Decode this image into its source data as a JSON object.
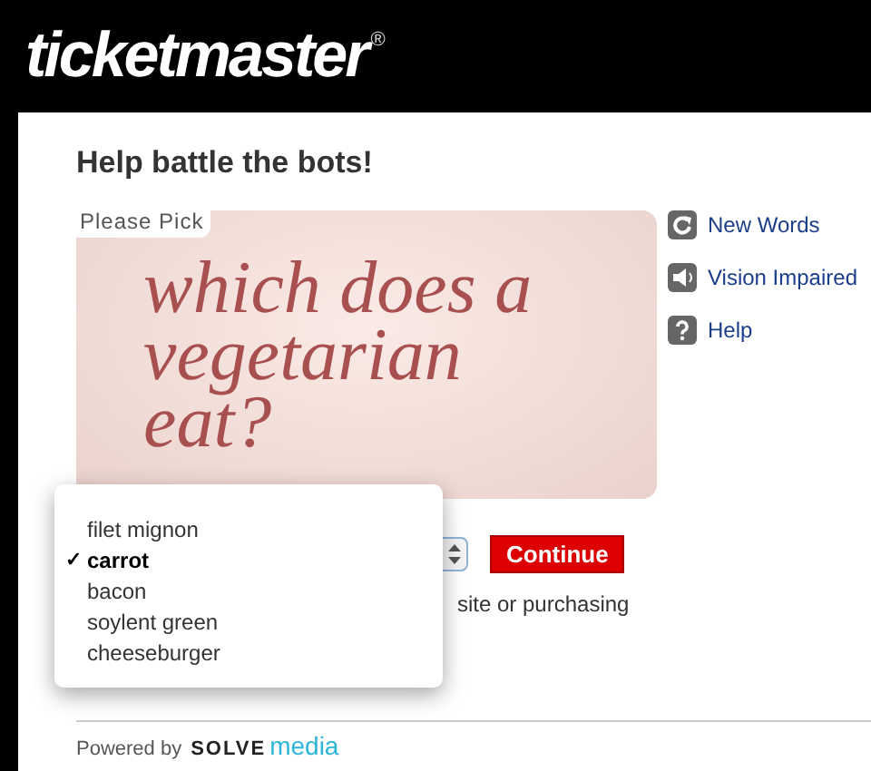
{
  "header": {
    "logo": "ticketmaster",
    "logo_mark": "®"
  },
  "heading": "Help battle the bots!",
  "captcha": {
    "tab_label": "Please Pick",
    "question": "which does a vegetarian eat?"
  },
  "links": [
    {
      "kind": "refresh",
      "label": "New Words"
    },
    {
      "kind": "audio",
      "label": "Vision Impaired"
    },
    {
      "kind": "help",
      "label": "Help"
    }
  ],
  "continue_button": "Continue",
  "note": "site or purchasing",
  "dropdown_menu": [
    {
      "label": "filet mignon",
      "selected": false
    },
    {
      "label": "carrot",
      "selected": true
    },
    {
      "label": "bacon",
      "selected": false
    },
    {
      "label": "soylent green",
      "selected": false
    },
    {
      "label": "cheeseburger",
      "selected": false
    }
  ],
  "check_mark": "✓",
  "footer": {
    "powered_by": "Powered by",
    "brand_bold": "SOLVE",
    "brand_light": "media"
  }
}
